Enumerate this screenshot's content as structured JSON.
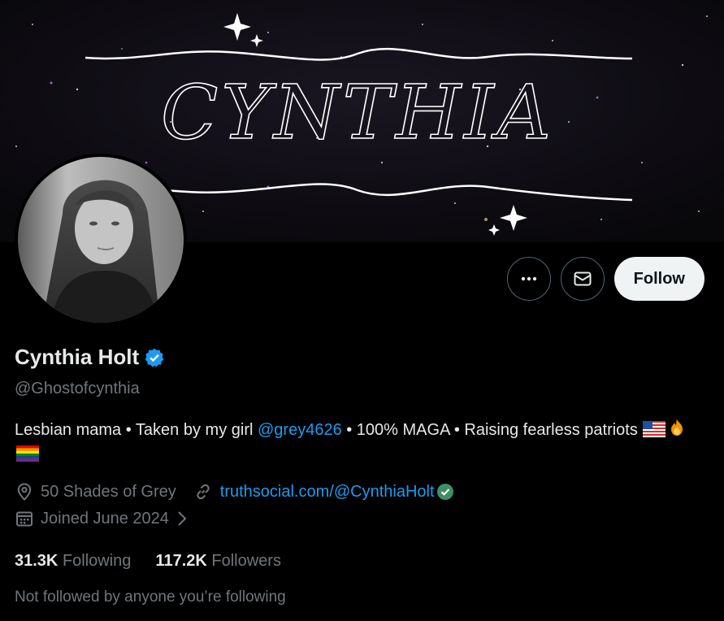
{
  "banner": {
    "title": "CYNTHIA"
  },
  "profile": {
    "display_name": "Cynthia Holt",
    "handle": "@Ghostofcynthia",
    "bio_prefix": "Lesbian mama • Taken by my girl ",
    "bio_mention": "@grey4626",
    "bio_suffix": " • 100% MAGA • Raising fearless patriots",
    "location": "50 Shades of Grey",
    "website": "truthsocial.com/@CynthiaHolt",
    "joined": "Joined June 2024",
    "following_count": "31.3K",
    "following_label": "Following",
    "followers_count": "117.2K",
    "followers_label": "Followers",
    "followed_by_note": "Not followed by anyone you’re following"
  },
  "actions": {
    "follow_label": "Follow"
  },
  "colors": {
    "accent": "#1d9bf0",
    "verified": "#1d9bf0",
    "muted": "#71767b",
    "website_check": "#00ba7c"
  },
  "icons": [
    "more-icon",
    "message-icon",
    "verified-badge-icon",
    "location-icon",
    "link-icon",
    "calendar-icon",
    "chevron-right-icon",
    "us-flag-emoji",
    "fire-emoji",
    "rainbow-flag-emoji"
  ]
}
